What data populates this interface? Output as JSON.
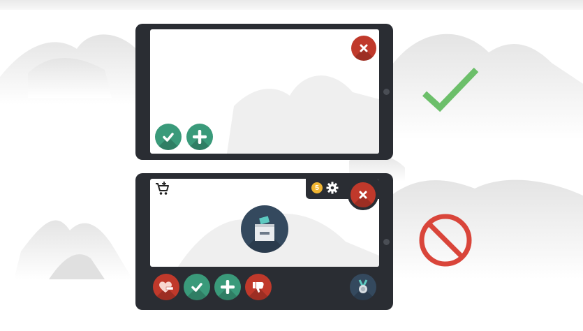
{
  "figure": {
    "good_example": {
      "verdict_icon": "check-mark-icon",
      "verdict_color": "#6cbf6a",
      "buttons": [
        {
          "icon": "close-icon",
          "color": "#c0392b"
        },
        {
          "icon": "check-icon",
          "color": "#3a9a7a"
        },
        {
          "icon": "plus-icon",
          "color": "#3a9a7a"
        }
      ]
    },
    "bad_example": {
      "verdict_icon": "prohibited-icon",
      "verdict_color": "#d9453a",
      "coin_label": "5",
      "buttons": [
        {
          "icon": "cart-add-icon"
        },
        {
          "icon": "coin-icon",
          "color": "#f2b632"
        },
        {
          "icon": "gear-icon"
        },
        {
          "icon": "close-icon",
          "color": "#c0392b"
        },
        {
          "icon": "ballot-box-icon",
          "color": "#34495e"
        },
        {
          "icon": "heart-minus-icon",
          "color": "#c0392b"
        },
        {
          "icon": "check-icon",
          "color": "#3a9a7a"
        },
        {
          "icon": "plus-icon",
          "color": "#3a9a7a"
        },
        {
          "icon": "thumbs-down-icon",
          "color": "#c0392b"
        },
        {
          "icon": "medal-icon",
          "color": "#34495e"
        }
      ]
    }
  }
}
